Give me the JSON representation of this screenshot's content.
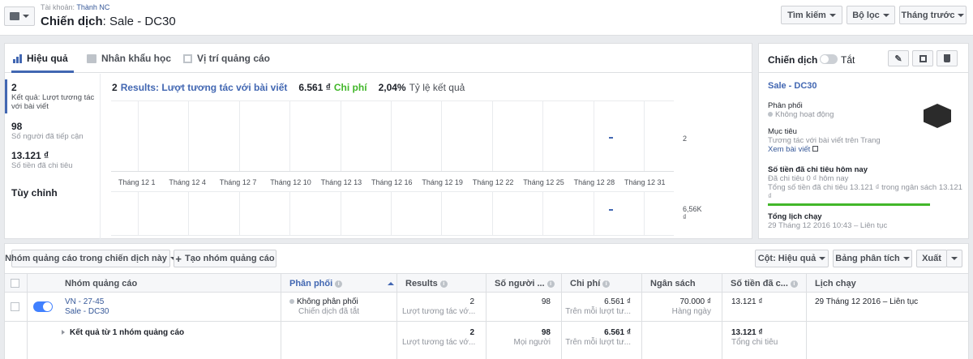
{
  "header": {
    "account_label": "Tài khoản:",
    "account_name": "Thành NC",
    "campaign_prefix": "Chiến dịch",
    "campaign_title": ": Sale - DC30",
    "search_label": "Tìm kiếm",
    "filter_label": "Bộ lọc",
    "date_label": "Tháng trước"
  },
  "tabs": [
    {
      "label": "Hiệu quả"
    },
    {
      "label": "Nhân khẩu học"
    },
    {
      "label": "Vị trí quảng cáo"
    }
  ],
  "metrics": [
    {
      "value": "2",
      "label": "Kết quả: Lượt tương tác với bài viết"
    },
    {
      "value": "98",
      "label": "Số người đã tiếp cận"
    },
    {
      "value": "13.121 ₫",
      "label": "Số tiền đã chi tiêu"
    }
  ],
  "customize_label": "Tùy chỉnh",
  "summary": {
    "results_count": "2",
    "results_label": "Results: Lượt tương tác với bài viết",
    "cost_value": "6.561 ₫",
    "cost_label": "Chi phí",
    "rate_value": "2,04%",
    "rate_label": "Tỷ lệ kết quả"
  },
  "chart_data": {
    "type": "line",
    "x_ticks": [
      "Tháng 12 1",
      "Tháng 12 4",
      "Tháng 12 7",
      "Tháng 12 10",
      "Tháng 12 13",
      "Tháng 12 16",
      "Tháng 12 19",
      "Tháng 12 22",
      "Tháng 12 25",
      "Tháng 12 28",
      "Tháng 12 31"
    ],
    "panels": [
      {
        "name": "Results",
        "axis_label": "2",
        "points": [
          {
            "x": "Tháng 12 29",
            "y": 2
          }
        ]
      },
      {
        "name": "Chi phí",
        "axis_label": "6,56K ₫",
        "points": [
          {
            "x": "Tháng 12 29",
            "y": 6561
          }
        ]
      }
    ],
    "grid": true
  },
  "side": {
    "header_label": "Chiến dịch",
    "toggle_label": "Tắt",
    "campaign_name": "Sale - DC30",
    "delivery_title": "Phân phối",
    "delivery_value": "Không hoạt động",
    "objective_title": "Mục tiêu",
    "objective_value": "Tương tác với bài viết trên Trang",
    "view_post": "Xem bài viết",
    "spent_title": "Số tiền đã chi tiêu hôm nay",
    "spent_line1": "Đã chi tiêu 0 ₫ hôm nay",
    "spent_line2": "Tổng số tiền đã chi tiêu 13.121 ₫ trong ngân sách 13.121 ₫",
    "schedule_title": "Tổng lịch chạy",
    "schedule_value": "29 Tháng 12 2016 10:43 – Liên tục"
  },
  "toolbar": {
    "adset_dropdown": "Nhóm quảng cáo trong chiến dịch này",
    "create_label": "Tạo nhóm quảng cáo",
    "columns_label": "Cột: Hiệu quả",
    "breakdown_label": "Bảng phân tích",
    "export_label": "Xuất"
  },
  "table": {
    "headers": [
      "Nhóm quảng cáo",
      "Phân phối",
      "Results",
      "Số người ...",
      "Chi phí",
      "Ngân sách",
      "Số tiền đã c...",
      "Lịch chạy"
    ],
    "row": {
      "name": "VN - 27-45",
      "campaign": "Sale - DC30",
      "delivery": "Không phân phối",
      "delivery_sub": "Chiến dịch đã tắt",
      "results": "2",
      "results_sub": "Lượt tương tác vớ...",
      "reach": "98",
      "cost": "6.561 ₫",
      "cost_sub": "Trên mỗi lượt tư...",
      "budget": "70.000 ₫",
      "budget_sub": "Hàng ngày",
      "spent": "13.121 ₫",
      "schedule": "29 Tháng 12 2016 – Liên tục"
    },
    "total": {
      "label": "Kết quả từ 1 nhóm quảng cáo",
      "results": "2",
      "results_sub": "Lượt tương tác vớ...",
      "reach": "98",
      "reach_sub": "Mọi người",
      "cost": "6.561 ₫",
      "cost_sub": "Trên mỗi lượt tư...",
      "spent": "13.121 ₫",
      "spent_sub": "Tổng chi tiêu"
    }
  },
  "colors": {
    "accent": "#4267b2",
    "cost": "#42b72a",
    "toggle": "#4080ff"
  }
}
